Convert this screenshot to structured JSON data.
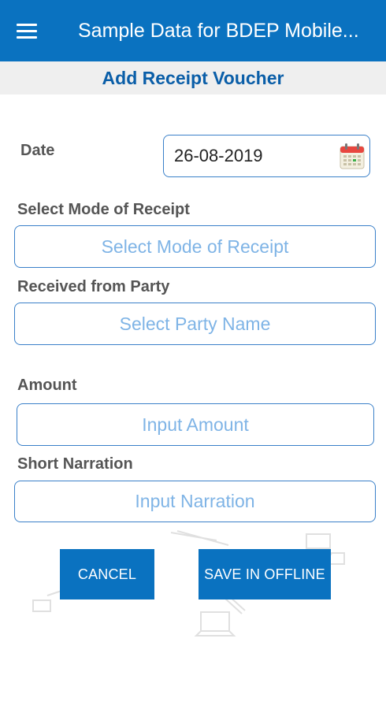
{
  "app_bar": {
    "title": "Sample Data for BDEP Mobile...",
    "menu_icon": "hamburger-menu-icon",
    "color": "#0a72c0"
  },
  "page": {
    "heading": "Add Receipt Voucher"
  },
  "form": {
    "date": {
      "label": "Date",
      "value": "26-08-2019",
      "icon": "calendar-icon"
    },
    "mode_of_receipt": {
      "label": "Select Mode of Receipt",
      "placeholder": "Select Mode of Receipt"
    },
    "party": {
      "label": "Received from Party",
      "placeholder": "Select Party Name"
    },
    "amount": {
      "label": "Amount",
      "placeholder": "Input Amount"
    },
    "narration": {
      "label": "Short Narration",
      "placeholder": "Input Narration"
    }
  },
  "actions": {
    "cancel_label": "CANCEL",
    "save_offline_label": "SAVE IN OFFLINE"
  },
  "colors": {
    "accent": "#0a72c0",
    "heading_text": "#0a5ea8",
    "placeholder_text": "#7fb4e6",
    "field_border": "#3a80c9"
  }
}
